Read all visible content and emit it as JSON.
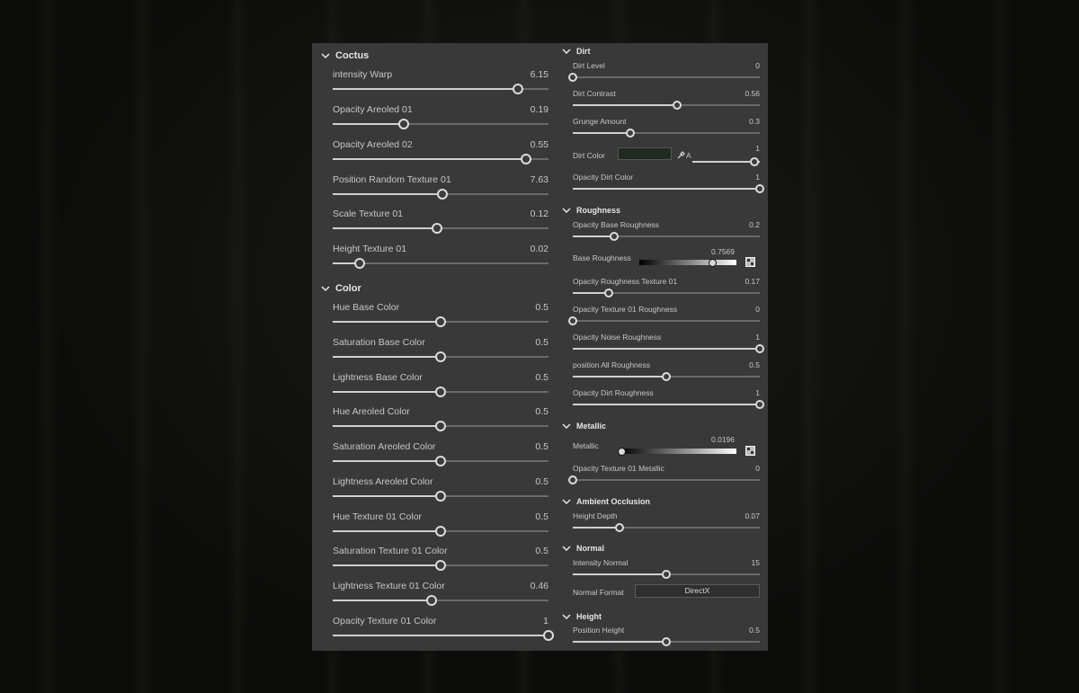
{
  "sections": {
    "coctus": "Coctus",
    "color": "Color",
    "dirt": "Dirt",
    "roughness": "Roughness",
    "metallic": "Metallic",
    "ambient_occlusion": "Ambient Occlusion",
    "normal": "Normal",
    "height": "Height"
  },
  "coctus": [
    {
      "label": "intensity Warp",
      "value": "6.15",
      "fraction": 0.86
    },
    {
      "label": "Opacity Areoled 01",
      "value": "0.19",
      "fraction": 0.33
    },
    {
      "label": "Opacity Areoled 02",
      "value": "0.55",
      "fraction": 0.895
    },
    {
      "label": "Position Random Texture 01",
      "value": "7.63",
      "fraction": 0.51
    },
    {
      "label": "Scale Texture 01",
      "value": "0.12",
      "fraction": 0.485
    },
    {
      "label": "Height Texture 01",
      "value": "0.02",
      "fraction": 0.125
    }
  ],
  "color": [
    {
      "label": "Hue Base Color",
      "value": "0.5",
      "fraction": 0.5
    },
    {
      "label": "Saturation Base Color",
      "value": "0.5",
      "fraction": 0.5
    },
    {
      "label": "Lightness Base Color",
      "value": "0.5",
      "fraction": 0.5
    },
    {
      "label": "Hue Areoled Color",
      "value": "0.5",
      "fraction": 0.5
    },
    {
      "label": "Saturation Areoled Color",
      "value": "0.5",
      "fraction": 0.5
    },
    {
      "label": "Lightness Areoled Color",
      "value": "0.5",
      "fraction": 0.5
    },
    {
      "label": "Hue Texture 01 Color",
      "value": "0.5",
      "fraction": 0.5
    },
    {
      "label": "Saturation Texture 01 Color",
      "value": "0.5",
      "fraction": 0.5
    },
    {
      "label": "Lightness Texture 01 Color",
      "value": "0.46",
      "fraction": 0.46
    },
    {
      "label": "Opacity Texture 01 Color",
      "value": "1",
      "fraction": 1.0
    }
  ],
  "dirt": {
    "level": {
      "label": "Dirt Level",
      "value": "0",
      "fraction": 0.0
    },
    "contrast": {
      "label": "Dirt Contrast",
      "value": "0.56",
      "fraction": 0.56
    },
    "grunge": {
      "label": "Grunge Amount",
      "value": "0.3",
      "fraction": 0.31
    },
    "color": {
      "label": "Dirt Color",
      "alpha_label": "A",
      "alpha_value": "1",
      "swatch": "#1f2a20"
    },
    "opacity_color": {
      "label": "Opacity Dirt Color",
      "value": "1",
      "fraction": 1.0
    }
  },
  "roughness": {
    "opacity_base": {
      "label": "Opacity Base Roughness",
      "value": "0.2",
      "fraction": 0.22
    },
    "base": {
      "label": "Base Roughness",
      "value": "0.7569",
      "fraction": 0.7569
    },
    "rest": [
      {
        "label": "Opacity Roughness Texture 01",
        "value": "0.17",
        "fraction": 0.19
      },
      {
        "label": "Opacity Texture 01 Roughness",
        "value": "0",
        "fraction": 0.0
      },
      {
        "label": "Opacity Noise Roughness",
        "value": "1",
        "fraction": 1.0
      },
      {
        "label": "position All Roughness",
        "value": "0.5",
        "fraction": 0.5
      },
      {
        "label": "Opacity Dirt Roughness",
        "value": "1",
        "fraction": 1.0
      }
    ]
  },
  "metallic": {
    "base": {
      "label": "Metallic",
      "value": "0.0196",
      "fraction": 0.0196
    },
    "texture": {
      "label": "Opacity Texture 01 Metallic",
      "value": "0",
      "fraction": 0.0
    }
  },
  "ao": {
    "label": "Height Depth",
    "value": "0.07",
    "fraction": 0.25
  },
  "normal": {
    "intensity": {
      "label": "Intensity Normal",
      "value": "15",
      "fraction": 0.5
    },
    "format_label": "Normal Format",
    "format_value": "DirectX"
  },
  "height": {
    "label": "Position Height",
    "value": "0.5",
    "fraction": 0.5
  },
  "icons": [
    "chevron-down-icon",
    "eyedropper-icon",
    "gradient-picker-icon"
  ]
}
